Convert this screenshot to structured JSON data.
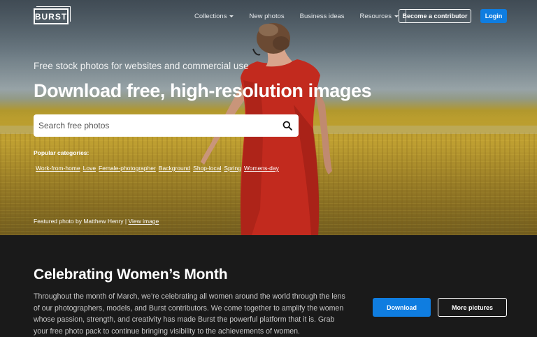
{
  "brand": {
    "logo_text": "BURST"
  },
  "nav": {
    "items": [
      {
        "label": "Collections",
        "dropdown": true
      },
      {
        "label": "New photos",
        "dropdown": false
      },
      {
        "label": "Business ideas",
        "dropdown": false
      },
      {
        "label": "Resources",
        "dropdown": true
      }
    ],
    "contributor_label": "Become a contributor",
    "login_label": "Login"
  },
  "hero": {
    "tagline": "Free stock photos for websites and commercial use",
    "headline": "Download free, high-resolution images",
    "search": {
      "placeholder": "Search free photos",
      "icon": "search-icon"
    },
    "popular_label": "Popular categories:",
    "categories": [
      "Work-from-home",
      "Love",
      "Female-photographer",
      "Background",
      "Shop-local",
      "Spring",
      "Womens-day"
    ],
    "featured_prefix": "Featured photo by Matthew Henry |",
    "featured_link": "View image"
  },
  "promo": {
    "title": "Celebrating Women’s Month",
    "body": "Throughout the month of March, we’re celebrating all women around the world through the lens of our photographers, models, and Burst contributors. We come together to amplify the women whose passion, strength, and creativity has made Burst the powerful platform that it is. Grab your free photo pack to continue bringing visibility to the achievements of women.",
    "download_label": "Download",
    "more_label": "More pictures"
  },
  "colors": {
    "accent": "#0f7de0",
    "promo_background": "#1a1a1a"
  }
}
